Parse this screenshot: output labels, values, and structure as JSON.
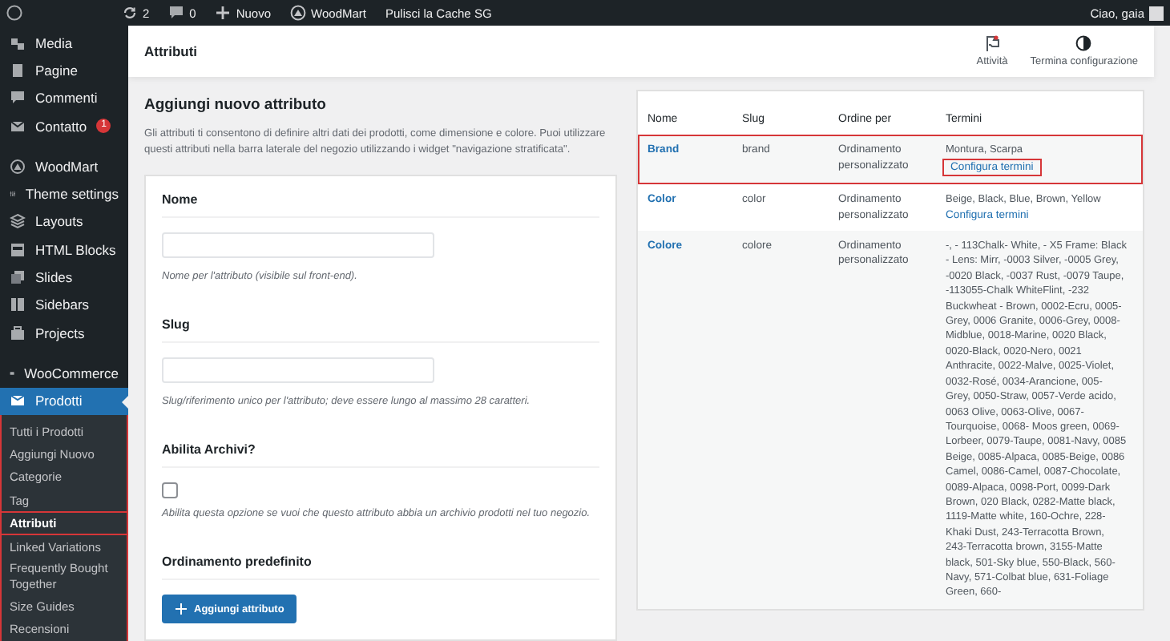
{
  "admin_bar": {
    "updates": "2",
    "comments": "0",
    "new_label": "Nuovo",
    "site": "WoodMart",
    "cache": "Pulisci la Cache SG",
    "greeting": "Ciao, gaia"
  },
  "sidebar": {
    "groups": [
      {
        "items": [
          {
            "label": "Media",
            "current": false
          },
          {
            "label": "Pagine",
            "current": false
          },
          {
            "label": "Commenti",
            "current": false
          },
          {
            "label": "Contatto",
            "badge": "1",
            "current": false
          }
        ]
      },
      {
        "items": [
          {
            "label": "WoodMart",
            "current": false
          },
          {
            "label": "Theme settings",
            "current": false
          },
          {
            "label": "Layouts",
            "current": false
          },
          {
            "label": "HTML Blocks",
            "current": false
          },
          {
            "label": "Slides",
            "current": false
          },
          {
            "label": "Sidebars",
            "current": false
          },
          {
            "label": "Projects",
            "current": false
          }
        ]
      },
      {
        "items": [
          {
            "label": "WooCommerce",
            "current": false
          },
          {
            "label": "Prodotti",
            "current": true,
            "highlighted": true,
            "children": [
              {
                "label": "Tutti i Prodotti",
                "selected": false,
                "highlighted": false
              },
              {
                "label": "Aggiungi Nuovo",
                "selected": false,
                "highlighted": false
              },
              {
                "label": "Categorie",
                "selected": false,
                "highlighted": false
              },
              {
                "label": "Tag",
                "selected": false,
                "highlighted": false
              },
              {
                "label": "Attributi",
                "selected": true,
                "highlighted": true
              },
              {
                "label": "Linked Variations",
                "selected": false,
                "highlighted": false
              },
              {
                "label": "Frequently Bought Together",
                "selected": false,
                "highlighted": false
              },
              {
                "label": "Size Guides",
                "selected": false,
                "highlighted": false
              },
              {
                "label": "Recensioni",
                "selected": false,
                "highlighted": false
              }
            ]
          }
        ]
      }
    ]
  },
  "header": {
    "title": "Attributi",
    "actions": [
      {
        "label": "Attività"
      },
      {
        "label": "Termina configurazione"
      }
    ]
  },
  "form": {
    "title": "Aggiungi nuovo attributo",
    "description": "Gli attributi ti consentono di definire altri dati dei prodotti, come dimensione e colore. Puoi utilizzare questi attributi nella barra laterale del negozio utilizzando i widget \"navigazione stratificata\".",
    "fields": [
      {
        "kind": "text",
        "label": "Nome",
        "hint": "Nome per l'attributo (visibile sul front-end)."
      },
      {
        "kind": "text",
        "label": "Slug",
        "hint": "Slug/riferimento unico per l'attributo; deve essere lungo al massimo 28 caratteri."
      },
      {
        "kind": "checkbox",
        "label": "Abilita Archivi?",
        "checked": false,
        "hint": "Abilita questa opzione se vuoi che questo attributo abbia un archivio prodotti nel tuo negozio."
      },
      {
        "kind": "heading",
        "label": "Ordinamento predefinito"
      }
    ],
    "button": "Aggiungi attributo"
  },
  "table": {
    "columns": [
      "Nome",
      "Slug",
      "Ordine per",
      "Termini"
    ],
    "rows": [
      {
        "name": "Brand",
        "slug": "brand",
        "order": "Ordinamento personalizzato",
        "terms": "Montura, Scarpa",
        "link": "Configura termini",
        "highlighted": true,
        "link_highlighted": true
      },
      {
        "name": "Color",
        "slug": "color",
        "order": "Ordinamento personalizzato",
        "terms": "Beige, Black, Blue, Brown, Yellow",
        "link": "Configura termini",
        "highlighted": false,
        "link_highlighted": false
      },
      {
        "name": "Colore",
        "slug": "colore",
        "order": "Ordinamento personalizzato",
        "terms": "-, - 113Chalk- White, - X5 Frame: Black - Lens: Mirr, -0003 Silver, -0005 Grey, -0020 Black, -0037 Rust, -0079 Taupe, -113055-Chalk WhiteFlint, -232 Buckwheat - Brown, 0002-Ecru, 0005-Grey, 0006 Granite, 0006-Grey, 0008-Midblue, 0018-Marine, 0020 Black, 0020-Black, 0020-Nero, 0021 Anthracite, 0022-Malve, 0025-Violet, 0032-Rosé, 0034-Arancione, 005-Grey, 0050-Straw, 0057-Verde acido, 0063 Olive, 0063-Olive, 0067- Tourquoise, 0068- Moos green, 0069-Lorbeer, 0079-Taupe, 0081-Navy, 0085 Beige, 0085-Alpaca, 0085-Beige, 0086 Camel, 0086-Camel, 0087-Chocolate, 0089-Alpaca, 0098-Port, 0099-Dark Brown, 020 Black, 0282-Matte black, 1119-Matte white, 160-Ochre, 228-Khaki Dust, 243-Terracotta Brown, 243-Terracotta brown, 3155-Matte black, 501-Sky blue, 550-Black, 560-Navy, 571-Colbat blue, 631-Foliage Green, 660-",
        "highlighted": false
      }
    ]
  }
}
